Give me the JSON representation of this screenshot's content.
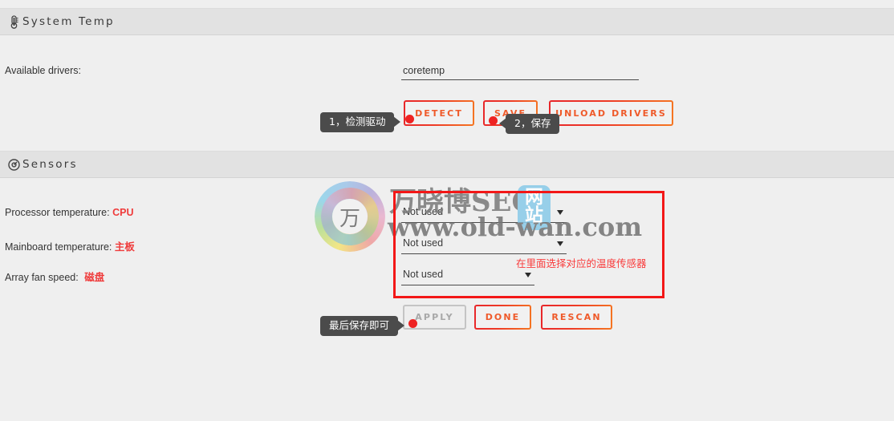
{
  "page": {
    "background": "#efefef",
    "accent_orange": "#ef5a2a",
    "accent_red": "#ee2222",
    "annotation_red": "#f31717"
  },
  "sections": {
    "system_temp": {
      "title": "System Temp",
      "icon": "thermometer-icon",
      "drivers_label": "Available drivers:",
      "drivers_value": "coretemp",
      "drivers_placeholder": "",
      "buttons": {
        "detect": "DETECT",
        "save": "SAVE",
        "unload": "UNLOAD DRIVERS"
      },
      "tooltips": {
        "detect": "1，检测驱动",
        "save": "2，保存"
      }
    },
    "sensors": {
      "title": "Sensors",
      "icon": "gauge-icon",
      "rows": [
        {
          "label": "Processor temperature:",
          "annotation": "CPU",
          "value": "Not used"
        },
        {
          "label": "Mainboard temperature:",
          "annotation": "主板",
          "value": "Not used"
        },
        {
          "label": "Array fan speed:",
          "annotation": "磁盘",
          "value": "Not used"
        }
      ],
      "annotation_note": "在里面选择对应的温度传感器",
      "buttons": {
        "apply": "APPLY",
        "done": "DONE",
        "rescan": "RESCAN"
      },
      "tooltips": {
        "apply": "最后保存即可"
      }
    }
  },
  "watermark": {
    "logo_glyph": "万",
    "line1": "万晓博SEO",
    "badge": "网站",
    "line2": "www.old-wan.com"
  }
}
